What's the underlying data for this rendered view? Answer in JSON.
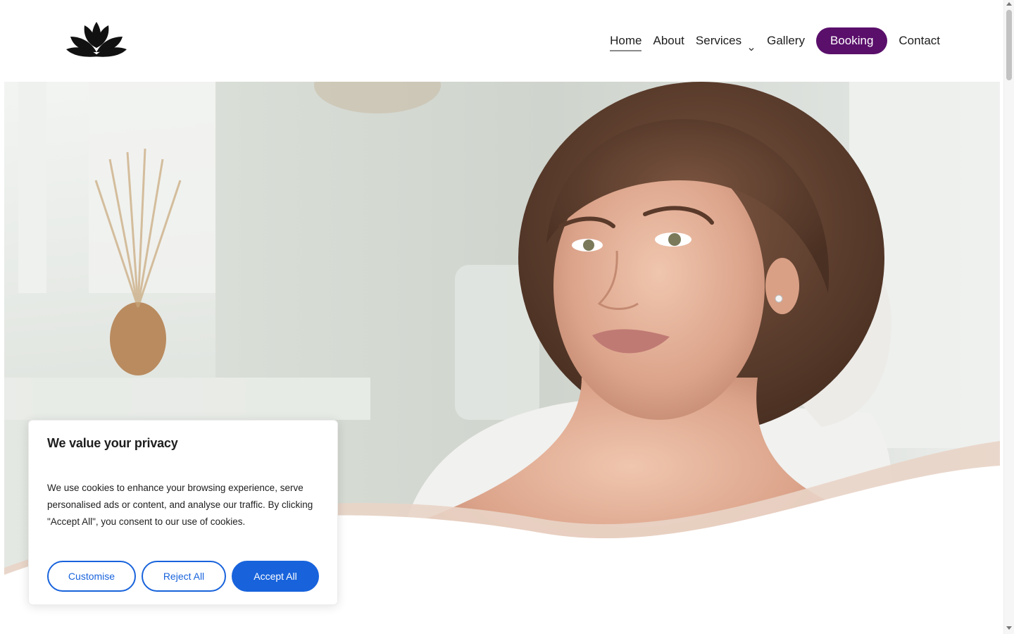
{
  "brand": {
    "logo_icon": "lotus-icon"
  },
  "nav": {
    "items": [
      {
        "label": "Home",
        "active": true
      },
      {
        "label": "About"
      },
      {
        "label": "Services",
        "has_dropdown": true
      },
      {
        "label": "Gallery"
      }
    ],
    "cta_label": "Booking",
    "last_label": "Contact"
  },
  "hero": {
    "image_description_icon": "hero-photo"
  },
  "cookie": {
    "title": "We value your privacy",
    "text": "We use cookies to enhance your browsing experience, serve personalised ads or content, and analyse our traffic. By clicking \"Accept All\", you consent to our use of cookies.",
    "customise_label": "Customise",
    "reject_label": "Reject All",
    "accept_label": "Accept All"
  },
  "colors": {
    "booking_bg": "#5a0f6b",
    "cookie_accent": "#1863dc"
  }
}
